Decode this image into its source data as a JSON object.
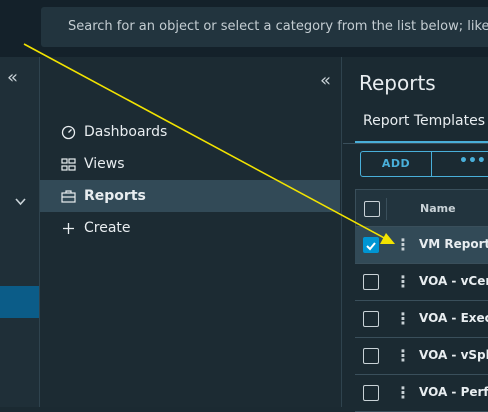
{
  "search": {
    "placeholder_text": "Search for an object or select a category from the list below; like me"
  },
  "nav": {
    "items": [
      {
        "label": "Dashboards",
        "icon": "dashboard-icon"
      },
      {
        "label": "Views",
        "icon": "views-icon"
      },
      {
        "label": "Reports",
        "icon": "reports-icon",
        "active": true
      },
      {
        "label": "Create",
        "icon": "plus-icon"
      }
    ]
  },
  "main": {
    "title": "Reports",
    "tab_label": "Report Templates",
    "add_label": "ADD",
    "more_label": "•••",
    "grid": {
      "name_header": "Name",
      "rows": [
        {
          "name": "VM Report",
          "selected": true
        },
        {
          "name": "VOA - vCen",
          "selected": false
        },
        {
          "name": "VOA - Execu",
          "selected": false
        },
        {
          "name": "VOA - vSphe",
          "selected": false
        },
        {
          "name": "VOA - Perfo",
          "selected": false
        }
      ]
    }
  },
  "colors": {
    "accent": "#49afd9",
    "checkbox": "#0095d3",
    "annotation_arrow": "#f2e300"
  }
}
